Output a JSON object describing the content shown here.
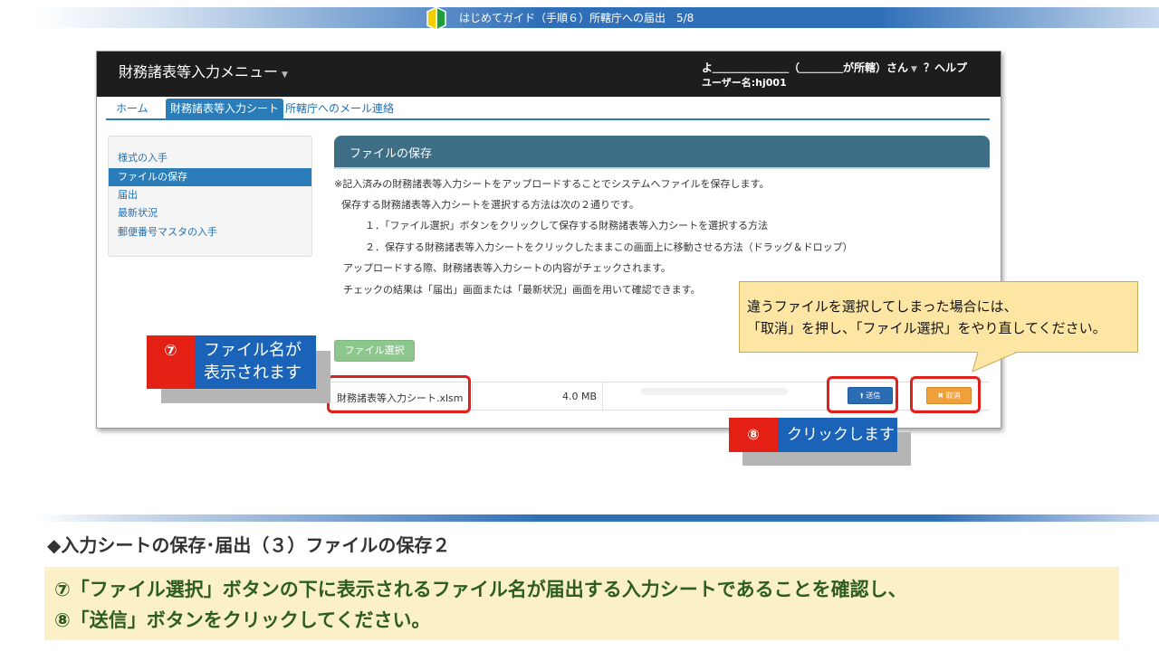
{
  "slide": {
    "banner_title": "はじめてガイド（手順６）所轄庁への届出　5/8",
    "icon": "beginner-mark-icon"
  },
  "app": {
    "brand": "財務諸表等入力メニュー",
    "user_name": "よ＿＿＿＿＿＿＿（＿＿＿＿が所轄）さん",
    "user_id": "ユーザー名:hj001",
    "help": "？ヘルプ",
    "tabs": [
      "ホーム",
      "財務諸表等入力シート",
      "所轄庁へのメール連絡"
    ],
    "sidebar": [
      "様式の入手",
      "ファイルの保存",
      "届出",
      "最新状況",
      "郵便番号マスタの入手"
    ],
    "panel_title": "ファイルの保存",
    "paragraphs": [
      "※記入済みの財務諸表等入力シートをアップロードすることでシステムへファイルを保存します。",
      "保存する財務諸表等入力シートを選択する方法は次の２通りです。",
      "１．「ファイル選択」ボタンをクリックして保存する財務諸表等入力シートを選択する方法",
      "２．保存する財務諸表等入力シートをクリックしたままこの画面上に移動させる方法（ドラッグ＆ドロップ）",
      "アップロードする際、財務諸表等入力シートの内容がチェックされます。",
      "チェックの結果は「届出」画面または「最新状況」画面を用いて確認できます。"
    ],
    "file_select_button": "ファイル選択",
    "file": {
      "name": "財務諸表等入力シート.xlsm",
      "size": "4.0 MB",
      "progress": 0
    },
    "send_button": "送信",
    "cancel_button": "取消"
  },
  "step7": {
    "num": "⑦",
    "text_line1": "ファイル名が",
    "text_line2": "表示されます"
  },
  "step8": {
    "num": "⑧",
    "text": "クリックします"
  },
  "callout": {
    "line1": "違うファイルを選択してしまった場合には、",
    "line2": "「取消」を押し、「ファイル選択」をやり直してください。"
  },
  "bottom": {
    "section_title": "◆入力シートの保存･届出（３）ファイルの保存２",
    "instruction_line1": "⑦「ファイル選択」ボタンの下に表示されるファイル名が届出する入力シートであることを確認し、",
    "instruction_line2": "⑧「送信」ボタンをクリックしてください。"
  },
  "colors": {
    "accent_blue": "#2a7db8",
    "step_red": "#e41f13",
    "step_blue": "#1a63b8",
    "callout_yellow": "#fde6a4",
    "instruction_green": "#2e5e1f"
  }
}
